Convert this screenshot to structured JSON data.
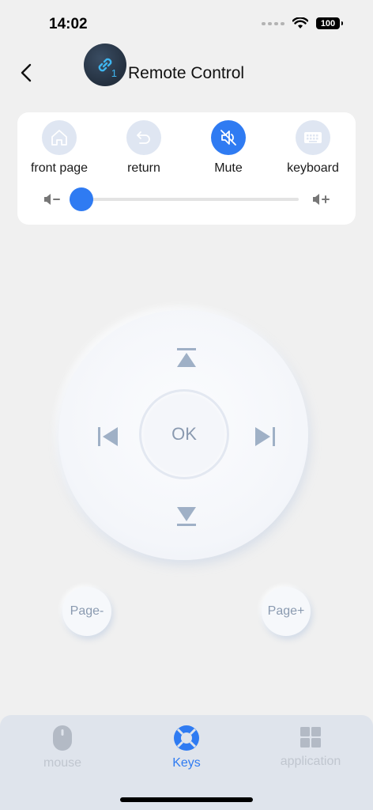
{
  "status": {
    "time": "14:02",
    "battery": "100"
  },
  "header": {
    "title": "Remote Control",
    "badge": "1"
  },
  "quick_actions": [
    {
      "label": "front page",
      "icon": "home-icon"
    },
    {
      "label": "return",
      "icon": "return-icon"
    },
    {
      "label": "Mute",
      "icon": "mute-icon",
      "active": true
    },
    {
      "label": "keyboard",
      "icon": "keyboard-icon"
    }
  ],
  "volume": {
    "level": 0.0
  },
  "dpad": {
    "ok_label": "OK"
  },
  "paging": {
    "prev_label": "Page-",
    "next_label": "Page+"
  },
  "tabs": [
    {
      "label": "mouse",
      "icon": "mouse-icon",
      "active": false
    },
    {
      "label": "Keys",
      "icon": "keys-icon",
      "active": true
    },
    {
      "label": "application",
      "icon": "application-grid-icon",
      "active": false
    }
  ],
  "colors": {
    "accent": "#2f7bf2",
    "icon_gray": "#9fb0c6",
    "background": "#f0f0f0"
  }
}
